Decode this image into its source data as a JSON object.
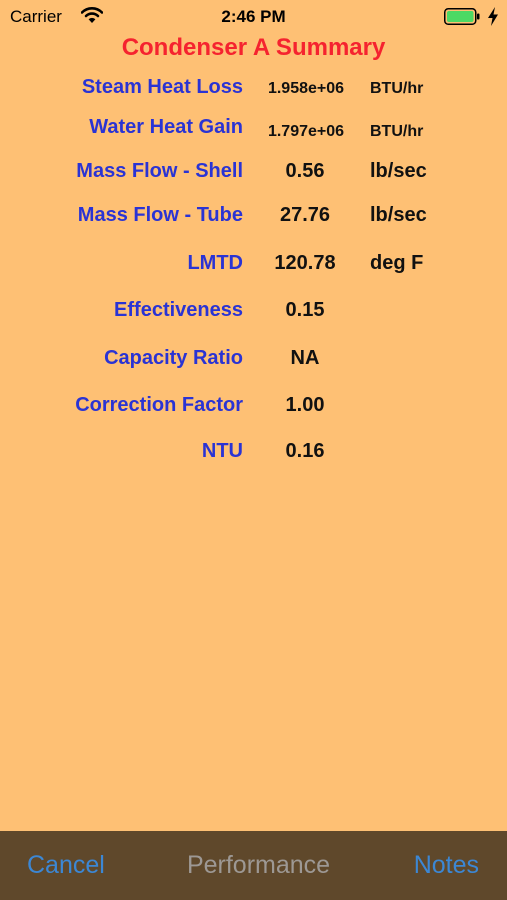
{
  "status_bar": {
    "carrier": "Carrier",
    "time": "2:46 PM",
    "icons": [
      "wifi-icon",
      "battery-icon",
      "charging-bolt-icon"
    ],
    "battery_color": "#4CD964"
  },
  "title": "Condenser A Summary",
  "colors": {
    "background": "#FEC074",
    "title": "#F5232F",
    "label": "#2A33D4",
    "value": "#111111",
    "toolbar_bg": "#5F482B",
    "toolbar_button": "#3C87D4",
    "toolbar_title": "#9D9894"
  },
  "rows": [
    {
      "label": "Steam Heat Loss",
      "value": "1.958e+06",
      "unit": "BTU/hr"
    },
    {
      "label": "Water Heat Gain",
      "value": "1.797e+06",
      "unit": "BTU/hr"
    },
    {
      "label": "Mass Flow - Shell",
      "value": "0.56",
      "unit": "lb/sec"
    },
    {
      "label": "Mass Flow - Tube",
      "value": "27.76",
      "unit": "lb/sec"
    },
    {
      "label": "LMTD",
      "value": "120.78",
      "unit": "deg F"
    },
    {
      "label": "Effectiveness",
      "value": "0.15",
      "unit": ""
    },
    {
      "label": "Capacity Ratio",
      "value": "NA",
      "unit": ""
    },
    {
      "label": "Correction Factor",
      "value": "1.00",
      "unit": ""
    },
    {
      "label": "NTU",
      "value": "0.16",
      "unit": ""
    }
  ],
  "toolbar": {
    "cancel_label": "Cancel",
    "title": "Performance",
    "notes_label": "Notes"
  }
}
